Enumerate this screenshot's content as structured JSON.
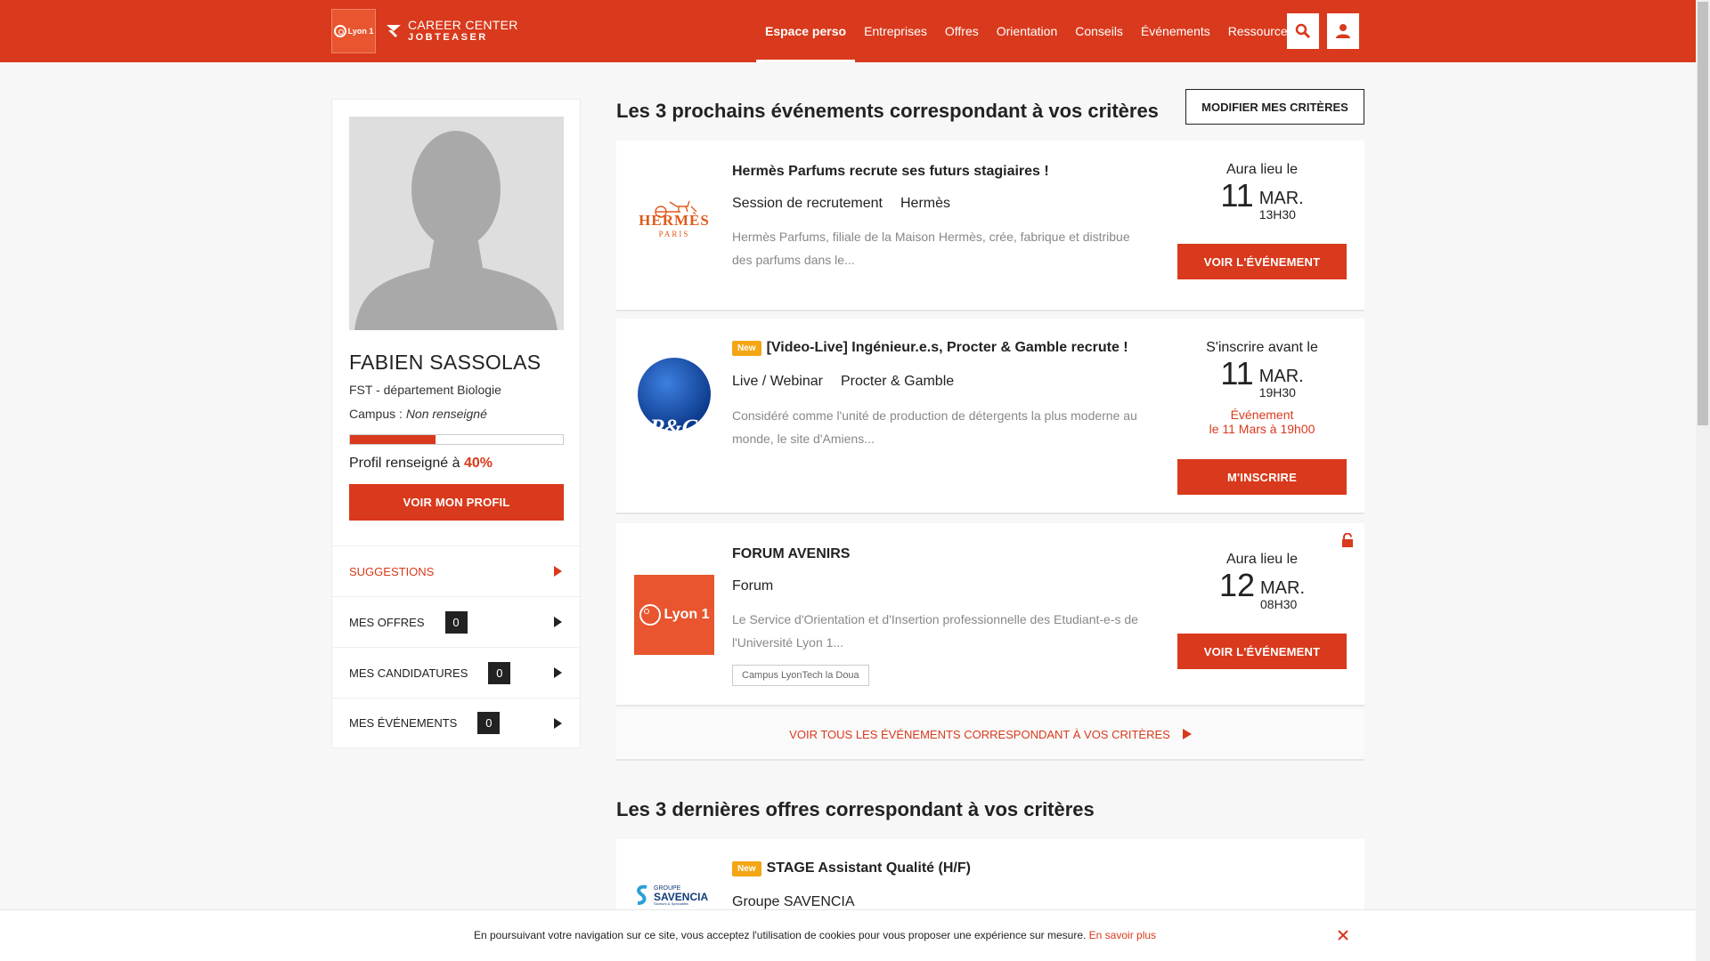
{
  "header": {
    "brand_school": "Lyon 1",
    "brand_line1": "CAREER CENTER",
    "brand_line2": "JOBTEASER",
    "nav": [
      "Espace perso",
      "Entreprises",
      "Offres",
      "Orientation",
      "Conseils",
      "Événements",
      "Ressources"
    ],
    "active_nav": "Espace perso",
    "search_icon": "search-icon",
    "account_icon": "user-icon"
  },
  "profile": {
    "name": "FABIEN SASSOLAS",
    "department": "FST - département Biologie",
    "campus_label": "Campus : ",
    "campus_value": "Non renseigné",
    "completion_label": "Profil renseigné à ",
    "completion_value": "40%",
    "completion_fraction": 0.4,
    "button": "VOIR MON PROFIL",
    "menu": [
      {
        "label": "SUGGESTIONS",
        "count": null,
        "highlighted": true
      },
      {
        "label": "MES OFFRES",
        "count": "0"
      },
      {
        "label": "MES CANDIDATURES",
        "count": "0"
      },
      {
        "label": "MES ÉVÉNEMENTS",
        "count": "0"
      }
    ]
  },
  "events_section": {
    "title": "Les 3 prochains événements correspondant à vos critères",
    "modify_button": "MODIFIER MES CRITÈRES",
    "see_all": "VOIR TOUS LES ÉVÉNEMENTS CORRESPONDANT À VOS CRITÈRES"
  },
  "events": [
    {
      "logo_word": "HERMÈS",
      "logo_sub": "PARIS",
      "badge": "",
      "title": "Hermès Parfums recrute ses futurs stagiaires !",
      "type": "Session de recrutement",
      "company": "Hermès",
      "description": "Hermès Parfums, filiale de la Maison Hermès, crée, fabrique et distribue des parfums dans le...",
      "date_label": "Aura lieu le",
      "day": "11",
      "month": "MAR.",
      "time": "13H30",
      "button": "VOIR L'ÉVÉNEMENT"
    },
    {
      "logo_word": "P&G",
      "badge": "New",
      "title": "[Video-Live] Ingénieur.e.s, Procter & Gamble recrute !",
      "type": "Live / Webinar",
      "company": "Procter & Gamble",
      "description": "Considéré comme l'unité de production de détergents la plus moderne au monde, le site d'Amiens...",
      "date_label": "S'inscrire avant le",
      "day": "11",
      "month": "MAR.",
      "time": "19H30",
      "note_line1": "Événement",
      "note_line2": "le 11 Mars à 19h00",
      "button": "M'INSCRIRE"
    },
    {
      "logo_word": "Lyon 1",
      "badge": "",
      "title": "FORUM AVENIRS",
      "type": "Forum",
      "company": "",
      "description": "Le Service d'Orientation et d'Insertion professionnelle des Etudiant-e-s de l'Université Lyon 1...",
      "tag": "Campus LyonTech la Doua",
      "date_label": "Aura lieu le",
      "day": "12",
      "month": "MAR.",
      "time": "08H30",
      "button": "VOIR L'ÉVÉNEMENT"
    }
  ],
  "offers_section": {
    "title": "Les 3 dernières offres correspondant à vos critères"
  },
  "offers": [
    {
      "logo_line1": "GROUPE",
      "logo_line2": "SAVENCIA",
      "logo_line3": "Saveurs & Spécialités",
      "badge": "New",
      "title": "STAGE Assistant Qualité (H/F)",
      "company": "Groupe SAVENCIA"
    }
  ],
  "cookie": {
    "text": "En poursuivant votre navigation sur ce site, vous acceptez l'utilisation de cookies pour vous proposer une expérience sur mesure. ",
    "link": "En savoir plus"
  },
  "colors": {
    "brand_red": "#d9391c",
    "new_badge": "#f4a614",
    "pg_blue": "#1a52b8"
  }
}
